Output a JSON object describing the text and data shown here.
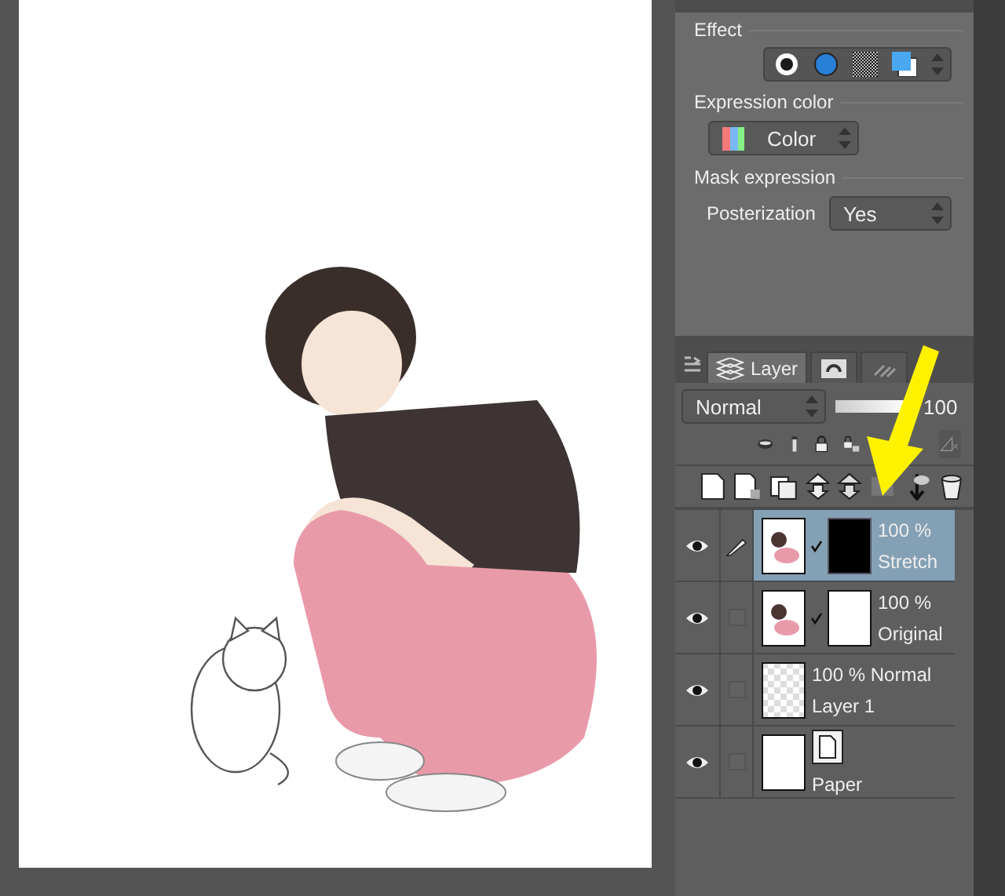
{
  "effect_panel": {
    "effect_label": "Effect",
    "expression_color_label": "Expression color",
    "expression_color_value": "Color",
    "mask_expression_label": "Mask expression",
    "posterization_label": "Posterization",
    "posterization_value": "Yes"
  },
  "layer_panel": {
    "tabs": [
      {
        "kind": "layer",
        "label": "Layer",
        "selected": true
      },
      {
        "kind": "icon",
        "selected": false
      },
      {
        "kind": "icon",
        "selected": false
      }
    ],
    "blend_mode": "Normal",
    "opacity": "100",
    "opacity_slider": {
      "level": 1
    },
    "layers": [
      {
        "kind": "masked",
        "info": "100 %",
        "name": "Stretch",
        "visible": true,
        "pen": true,
        "selected": true,
        "mask_filled": true
      },
      {
        "kind": "masked",
        "info": "100 %",
        "name": "Original",
        "visible": true,
        "pen": false,
        "selected": false,
        "mask_filled": false
      },
      {
        "kind": "raster",
        "info": "100 % Normal",
        "name": "Layer 1",
        "visible": true,
        "pen": false,
        "selected": false
      },
      {
        "kind": "paper",
        "name": "Paper",
        "visible": true,
        "pen": false,
        "selected": false
      }
    ]
  }
}
